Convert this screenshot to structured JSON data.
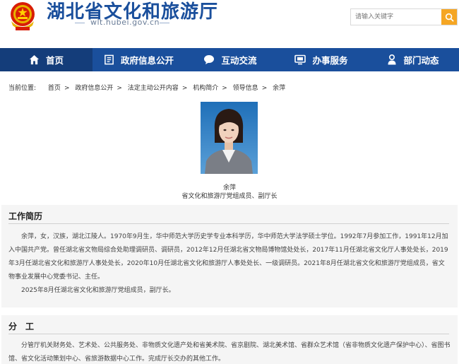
{
  "site": {
    "title": "湖北省文化和旅游厅",
    "url": "wlt.hubei.gov.cn"
  },
  "search": {
    "placeholder": "请输入关键字",
    "icon": "search-icon"
  },
  "nav": {
    "items": [
      {
        "label": "首页",
        "icon": "home-icon",
        "active": true
      },
      {
        "label": "政府信息公开",
        "icon": "document-icon"
      },
      {
        "label": "互动交流",
        "icon": "chat-bubble-icon"
      },
      {
        "label": "办事服务",
        "icon": "monitor-icon"
      },
      {
        "label": "部门动态",
        "icon": "person-icon"
      }
    ]
  },
  "breadcrumb": {
    "label": "当前位置:",
    "items": [
      "首页",
      "政府信息公开",
      "法定主动公开内容",
      "机构简介",
      "领导信息",
      "余萍"
    ]
  },
  "person": {
    "name": "余萍",
    "title": "省文化和旅游厅党组成员、副厅长"
  },
  "resume": {
    "heading": "工作简历",
    "paragraphs": [
      "余萍，女，汉族，湖北江陵人。1970年9月生，华中师范大学历史学专业本科学历，华中师范大学法学硕士学位。1992年7月参加工作，1991年12月加入中国共产党。曾任湖北省文物局综合处助理调研员、调研员，2012年12月任湖北省文物局博物馆处处长，2017年11月任湖北省文化厅人事处处长，2019年3月任湖北省文化和旅游厅人事处处长，2020年10月任湖北省文化和旅游厅人事处处长、一级调研员。2021年8月任湖北省文化和旅游厅党组成员，省文物事业发展中心党委书记、主任。",
      "2025年8月任湖北省文化和旅游厅党组成员，副厅长。"
    ]
  },
  "duty": {
    "heading": "分　工",
    "paragraphs": [
      "分管厅机关财务处、艺术处、公共服务处、非物质文化遗产处和省美术院、省京剧院、湖北美术馆、省群众艺术馆（省非物质文化遗产保护中心）、省图书馆、省文化活动策划中心、省旅游数据中心工作。完成厅长交办的其他工作。"
    ]
  },
  "colors": {
    "brand_blue": "#1a4f9c",
    "nav_active": "#143d7a",
    "search_button": "#f5a623",
    "section_bg": "#f5f5f5"
  }
}
